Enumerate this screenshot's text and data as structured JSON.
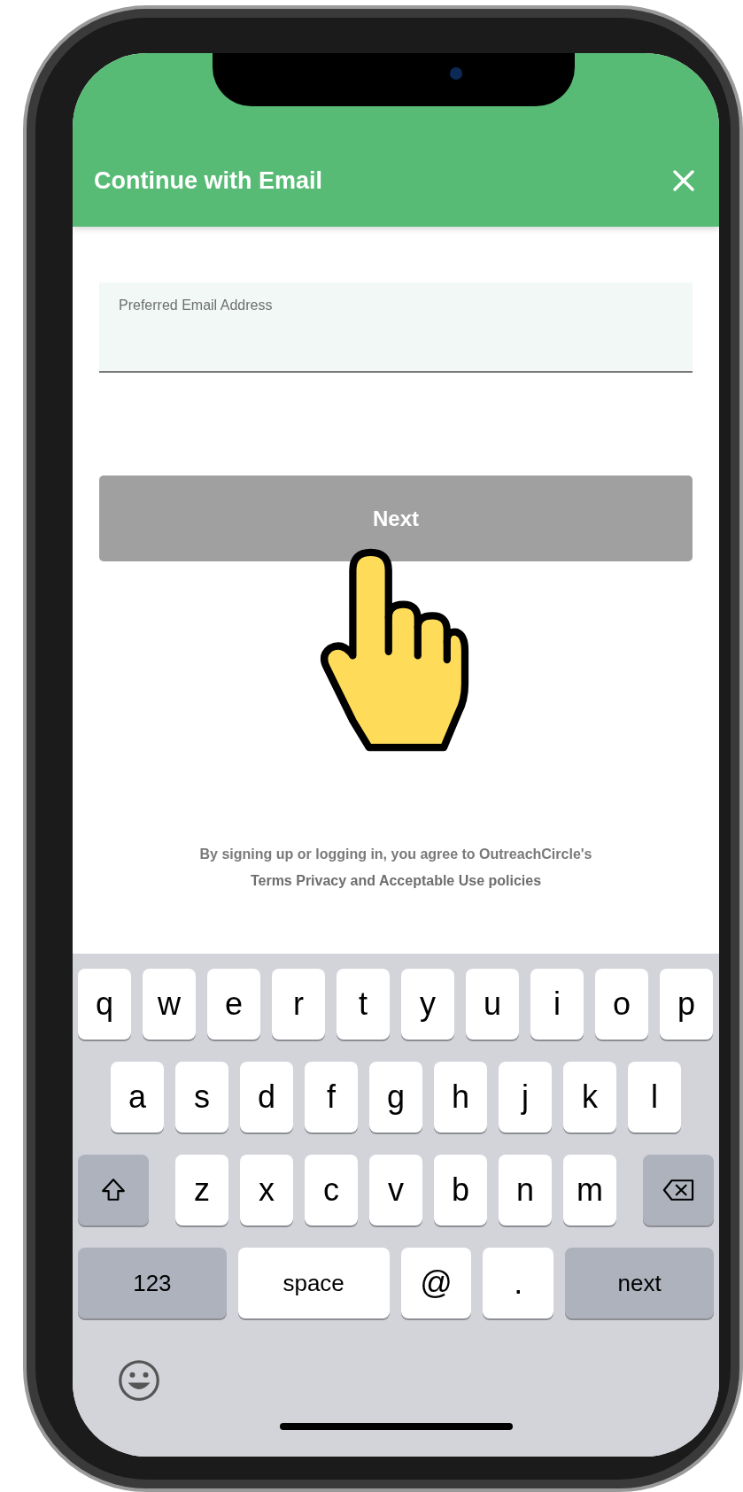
{
  "header": {
    "title": "Continue with Email"
  },
  "email_field": {
    "placeholder": "Preferred Email Address"
  },
  "next_button": {
    "label": "Next",
    "disabled": true
  },
  "footer": {
    "text": "By signing up or logging in, you agree to OutreachCircle's",
    "link": "Terms Privacy and Acceptable Use policies"
  },
  "keyboard": {
    "rows": [
      {
        "keys": [
          {
            "kind": "letter",
            "label": "q"
          },
          {
            "kind": "letter",
            "label": "w"
          },
          {
            "kind": "letter",
            "label": "e"
          },
          {
            "kind": "letter",
            "label": "r"
          },
          {
            "kind": "letter",
            "label": "t"
          },
          {
            "kind": "letter",
            "label": "y"
          },
          {
            "kind": "letter",
            "label": "u"
          },
          {
            "kind": "letter",
            "label": "i"
          },
          {
            "kind": "letter",
            "label": "o"
          },
          {
            "kind": "letter",
            "label": "p"
          }
        ]
      },
      {
        "keys": [
          {
            "kind": "letter",
            "label": "a"
          },
          {
            "kind": "letter",
            "label": "s"
          },
          {
            "kind": "letter",
            "label": "d"
          },
          {
            "kind": "letter",
            "label": "f"
          },
          {
            "kind": "letter",
            "label": "g"
          },
          {
            "kind": "letter",
            "label": "h"
          },
          {
            "kind": "letter",
            "label": "j"
          },
          {
            "kind": "letter",
            "label": "k"
          },
          {
            "kind": "letter",
            "label": "l"
          }
        ]
      },
      {
        "keys": [
          {
            "kind": "shift"
          },
          {
            "kind": "letter",
            "label": "z"
          },
          {
            "kind": "letter",
            "label": "x"
          },
          {
            "kind": "letter",
            "label": "c"
          },
          {
            "kind": "letter",
            "label": "v"
          },
          {
            "kind": "letter",
            "label": "b"
          },
          {
            "kind": "letter",
            "label": "n"
          },
          {
            "kind": "letter",
            "label": "m"
          },
          {
            "kind": "delete"
          }
        ]
      },
      {
        "keys": [
          {
            "kind": "mode",
            "label": "123"
          },
          {
            "kind": "space",
            "label": "space"
          },
          {
            "kind": "symbol",
            "label": "@"
          },
          {
            "kind": "symbol",
            "label": "."
          },
          {
            "kind": "return",
            "label": "next"
          }
        ]
      }
    ]
  }
}
